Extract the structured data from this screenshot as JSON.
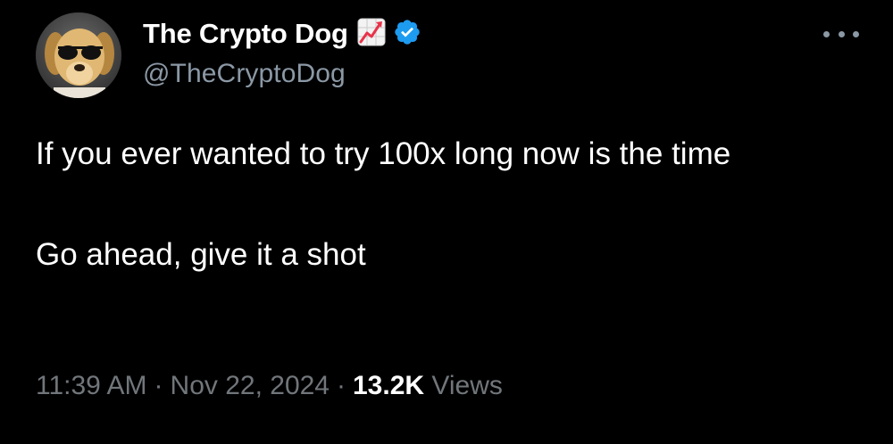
{
  "author": {
    "display_name": "The Crypto Dog",
    "handle": "@TheCryptoDog",
    "avatar_icon": "dog-with-sunglasses-avatar",
    "badges": [
      "chart-increasing-icon",
      "verified-badge-icon"
    ],
    "verified_color": "#1d9bf0"
  },
  "tweet": {
    "paragraphs": [
      "If you ever wanted to try 100x long now is the time",
      "Go ahead, give it a shot"
    ]
  },
  "meta": {
    "time": "11:39 AM",
    "separator": "·",
    "date": "Nov 22, 2024",
    "views_count": "13.2K",
    "views_label": "Views"
  },
  "more_menu_icon": "ellipsis-icon"
}
